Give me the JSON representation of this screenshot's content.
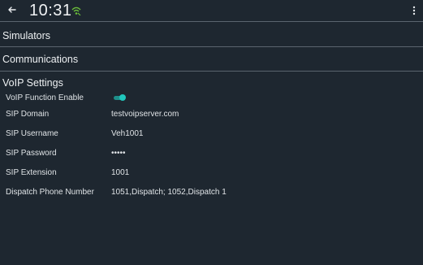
{
  "status_bar": {
    "time": "10:31",
    "back_icon": "arrow-left-icon",
    "network_icon": "wifi-signal-icon",
    "menu_icon": "more-vert-icon",
    "accent_color": "#6bbf3a"
  },
  "menu": {
    "simulators": "Simulators",
    "communications": "Communications"
  },
  "voip": {
    "section_title": "VoIP Settings",
    "toggle_color": "#20c7bd",
    "function_enable": {
      "label": "VoIP Function Enable",
      "enabled": true
    },
    "fields": [
      {
        "label": "SIP Domain",
        "value": "testvoipserver.com"
      },
      {
        "label": "SIP Username",
        "value": "Veh1001"
      },
      {
        "label": "SIP Password",
        "value": "•••••"
      },
      {
        "label": "SIP Extension",
        "value": "1001"
      },
      {
        "label": "Dispatch Phone Number",
        "value": "1051,Dispatch; 1052,Dispatch 1"
      }
    ]
  }
}
